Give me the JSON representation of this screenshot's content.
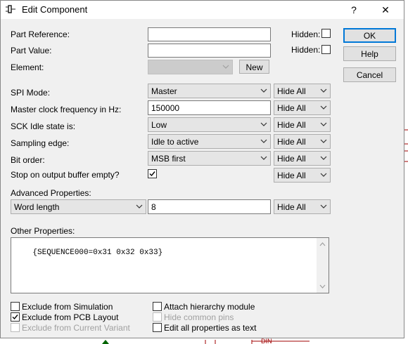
{
  "window": {
    "title": "Edit Component",
    "help_glyph": "?",
    "close_glyph": "✕"
  },
  "fields": {
    "part_reference": {
      "label": "Part Reference:",
      "value": ""
    },
    "part_value": {
      "label": "Part Value:",
      "value": ""
    },
    "element": {
      "label": "Element:",
      "value": "",
      "new_label": "New"
    },
    "hidden_label": "Hidden:"
  },
  "buttons": {
    "ok": "OK",
    "help": "Help",
    "cancel": "Cancel"
  },
  "properties": [
    {
      "label": "SPI Mode:",
      "kind": "combo",
      "value": "Master",
      "visibility": "Hide All"
    },
    {
      "label": "Master clock frequency in Hz:",
      "kind": "text",
      "value": "150000",
      "visibility": "Hide All"
    },
    {
      "label": "SCK Idle state is:",
      "kind": "combo",
      "value": "Low",
      "visibility": "Hide All"
    },
    {
      "label": "Sampling edge:",
      "kind": "combo",
      "value": "Idle to active",
      "visibility": "Hide All"
    },
    {
      "label": "Bit order:",
      "kind": "combo",
      "value": "MSB first",
      "visibility": "Hide All"
    },
    {
      "label": "Stop on output buffer empty?",
      "kind": "checkbox",
      "checked": true,
      "visibility": "Hide All"
    }
  ],
  "advanced": {
    "label": "Advanced Properties:",
    "property": "Word length",
    "value": "8",
    "visibility": "Hide All"
  },
  "other": {
    "label": "Other Properties:",
    "text": "{SEQUENCE000=0x31 0x32 0x33}"
  },
  "options": {
    "exclude_simulation": {
      "label": "Exclude from Simulation",
      "checked": false
    },
    "exclude_pcb": {
      "label": "Exclude from PCB Layout",
      "checked": true
    },
    "exclude_variant": {
      "label": "Exclude from Current Variant",
      "checked": false
    },
    "attach_hierarchy": {
      "label": "Attach hierarchy module",
      "checked": false
    },
    "hide_common_pins": {
      "label": "Hide common pins",
      "checked": false
    },
    "edit_as_text": {
      "label": "Edit all properties as text",
      "checked": false
    }
  },
  "schematic": {
    "pin_label": "DIN"
  },
  "colors": {
    "accent": "#0078d7",
    "schematic_wire": "#a00000",
    "schematic_bg": "#ffffff"
  }
}
